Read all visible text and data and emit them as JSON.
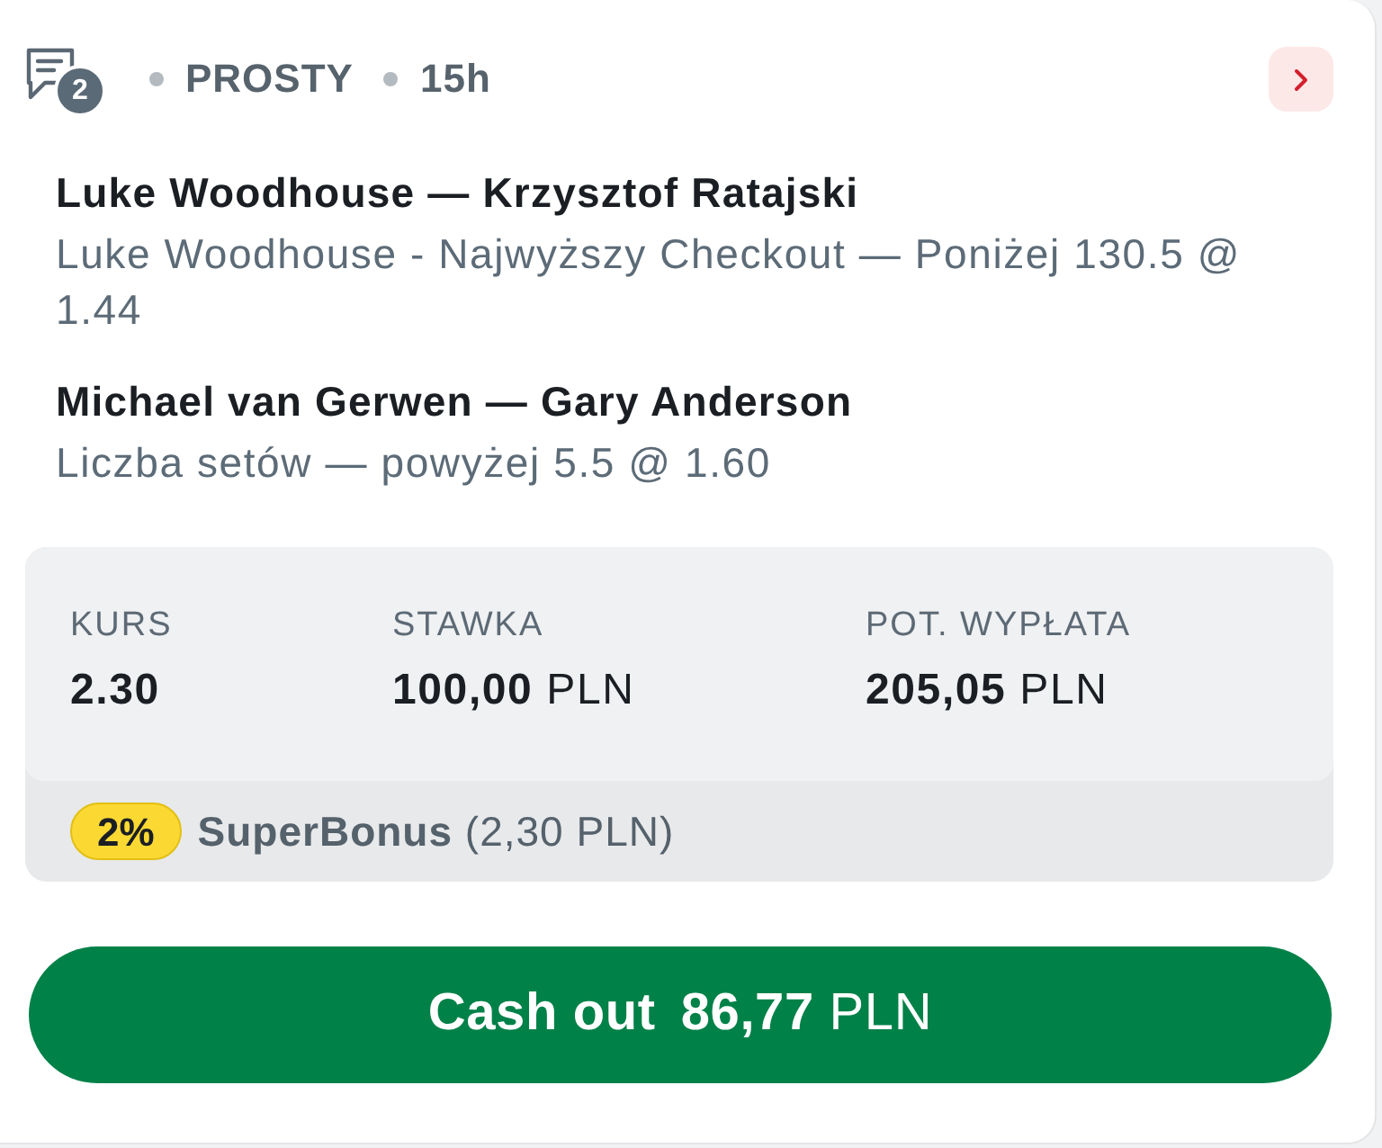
{
  "header": {
    "comments_count": "2",
    "bet_type": "PROSTY",
    "time": "15h"
  },
  "selections": [
    {
      "match": "Luke Woodhouse — Krzysztof Ratajski",
      "pick": "Luke Woodhouse - Najwyższy Checkout — Poniżej 130.5 @ 1.44"
    },
    {
      "match": "Michael van Gerwen — Gary Anderson",
      "pick": "Liczba setów — powyżej 5.5 @ 1.60"
    }
  ],
  "summary": {
    "fields": [
      {
        "label": "KURS",
        "value": "**2.30**"
      },
      {
        "label": "STAWKA",
        "value": "**100,00** PLN"
      },
      {
        "label": "POT. WYPŁATA",
        "value": "**205,05** PLN"
      }
    ],
    "bonus": {
      "badge": "2%",
      "text": "**SuperBonus** (2,30 PLN)"
    }
  },
  "cashout_button": {
    "label": "Cash out",
    "amount": "86,77",
    "currency": "PLN"
  }
}
